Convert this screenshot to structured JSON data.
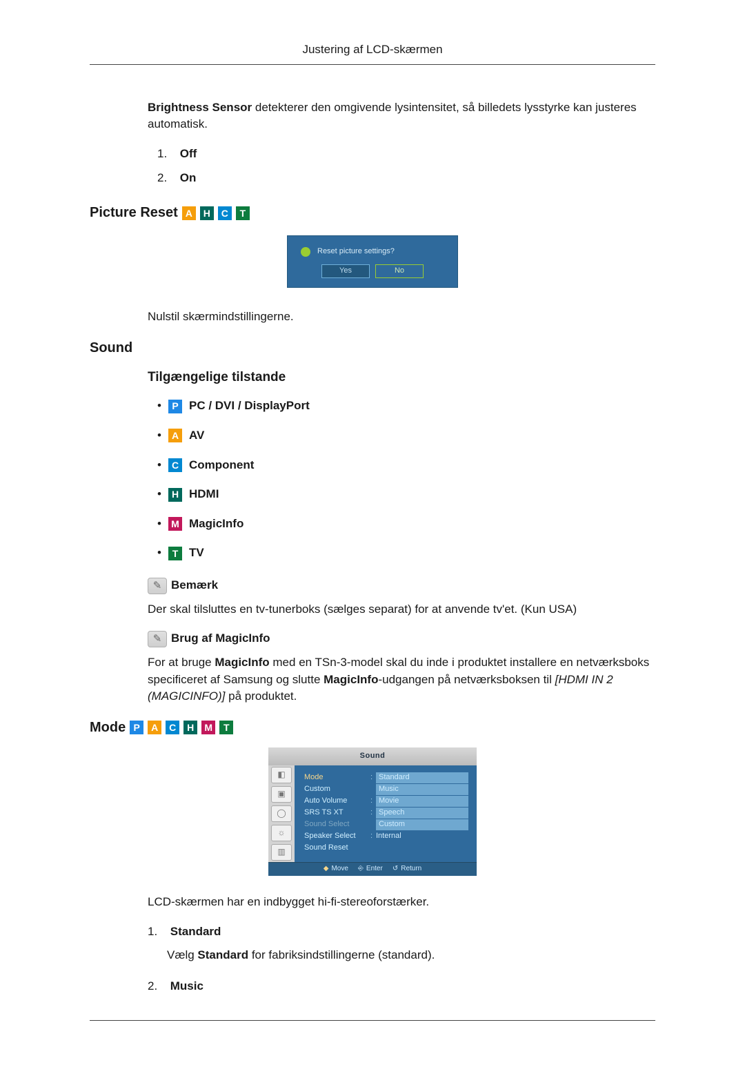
{
  "page_header": "Justering af LCD-skærmen",
  "brightness": {
    "lead_bold": "Brightness Sensor",
    "lead_rest": " detekterer den omgivende lysintensitet, så billedets lysstyrke kan justeres automatisk.",
    "items": [
      {
        "num": "1.",
        "label": "Off"
      },
      {
        "num": "2.",
        "label": "On"
      }
    ]
  },
  "picture_reset": {
    "heading": "Picture Reset",
    "dialog": {
      "question": "Reset picture settings?",
      "yes": "Yes",
      "no": "No"
    },
    "caption": "Nulstil skærmindstillingerne."
  },
  "sound": {
    "heading": "Sound",
    "modes_heading": "Tilgængelige tilstande",
    "modes": [
      {
        "badge": "P",
        "label": "PC / DVI / DisplayPort"
      },
      {
        "badge": "A",
        "label": "AV"
      },
      {
        "badge": "C",
        "label": "Component"
      },
      {
        "badge": "H",
        "label": "HDMI"
      },
      {
        "badge": "M",
        "label": "MagicInfo"
      },
      {
        "badge": "T",
        "label": "TV"
      }
    ],
    "note_label": "Bemærk",
    "note_text": "Der skal tilsluttes en tv-tunerboks (sælges separat) for at anvende tv'et. (Kun USA)",
    "magicinfo_label": "Brug af MagicInfo",
    "magicinfo_p1a": "For at bruge ",
    "magicinfo_bold1": "MagicInfo",
    "magicinfo_p1b": " med en TSn-3-model skal du inde i produktet installere en netværksboks specificeret af Samsung og slutte ",
    "magicinfo_bold2": "MagicInfo",
    "magicinfo_p1c": "-udgangen på netværksboksen til ",
    "magicinfo_italic": "[HDMI IN 2 (MAGICINFO)]",
    "magicinfo_p1d": " på produktet."
  },
  "mode": {
    "heading": "Mode",
    "menu": {
      "title": "Sound",
      "rows": [
        {
          "lbl": "Mode",
          "val": "Standard",
          "sel": true,
          "hl": true
        },
        {
          "lbl": "Custom",
          "val": "Music",
          "hl": true
        },
        {
          "lbl": "Auto Volume",
          "val": "Movie",
          "hl": true
        },
        {
          "lbl": "SRS TS XT",
          "val": "Speech",
          "hl": true
        },
        {
          "lbl": "Sound Select",
          "val": "Custom",
          "hl": true,
          "dim": true
        },
        {
          "lbl": "Speaker Select",
          "val": "Internal"
        },
        {
          "lbl": "Sound Reset",
          "val": ""
        }
      ],
      "footer": {
        "move": "Move",
        "enter": "Enter",
        "return": "Return"
      }
    },
    "summary": "LCD-skærmen har en indbygget hi-fi-stereoforstærker.",
    "items": [
      {
        "num": "1.",
        "label": "Standard",
        "desc_a": "Vælg ",
        "desc_bold": "Standard",
        "desc_b": " for fabriksindstillingerne (standard)."
      },
      {
        "num": "2.",
        "label": "Music"
      }
    ]
  }
}
